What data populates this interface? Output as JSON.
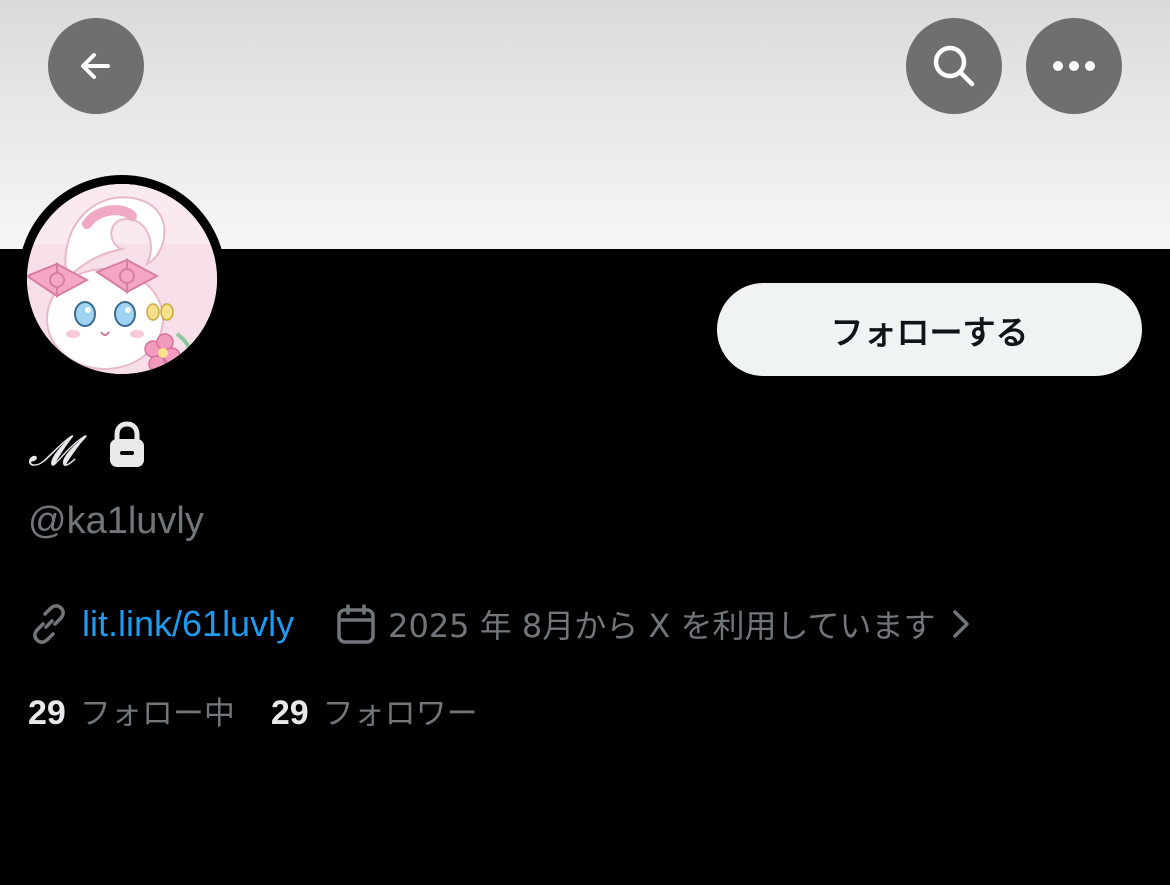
{
  "header": {
    "back_icon": "arrow-left-icon",
    "search_icon": "search-icon",
    "more_icon": "more-horizontal-icon",
    "button_color": "#6f6f6f"
  },
  "profile": {
    "display_name": "𝓜",
    "protected_icon": "lock-icon",
    "handle": "@ka1luvly",
    "follow_label": "フォローする",
    "website": "lit.link/61luvly",
    "joined": "2025 年 8月から X を利用しています"
  },
  "stats": {
    "following_count": "29",
    "following_label": "フォロー中",
    "followers_count": "29",
    "followers_label": "フォロワー"
  },
  "colors": {
    "background": "#000000",
    "link": "#1d9bf0",
    "muted_text": "#71767b",
    "primary_text": "#e7e9ea",
    "follow_button_bg": "#eff3f4"
  }
}
